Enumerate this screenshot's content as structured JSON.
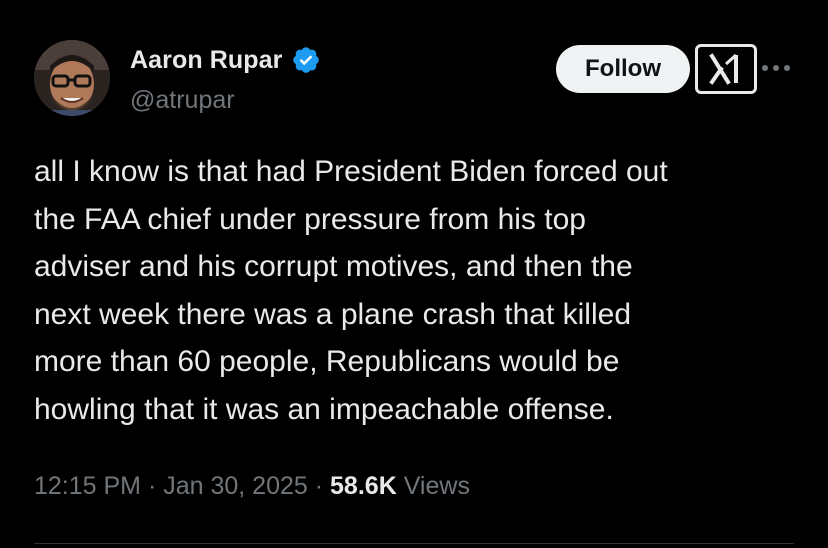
{
  "author": {
    "display_name": "Aaron Rupar",
    "handle": "@atrupar",
    "verified": true,
    "avatar_icon": "person-with-glasses-avatar"
  },
  "actions": {
    "follow_label": "Follow",
    "grok_icon": "grok-icon",
    "more_icon": "more-horizontal-icon"
  },
  "tweet": {
    "text": "all I know is that had President Biden forced out\nthe FAA chief under pressure from his top\nadviser and his corrupt motives, and then the\nnext week there was a plane crash that killed\nmore than 60 people, Republicans would be\nhowling that it was an impeachable offense."
  },
  "meta": {
    "time": "12:15 PM",
    "separator": " · ",
    "date": "Jan 30, 2025",
    "views_count": "58.6K",
    "views_label": "Views"
  },
  "colors": {
    "background": "#000000",
    "text": "#e7e9ea",
    "muted": "#71767b",
    "verified_blue": "#1d9bf0",
    "follow_bg": "#eff3f4"
  }
}
